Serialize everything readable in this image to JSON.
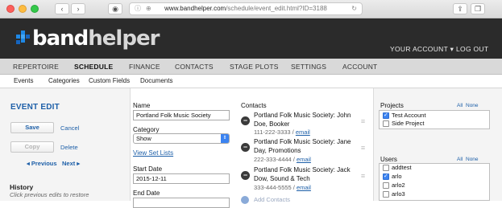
{
  "browser": {
    "url_domain": "www.bandhelper.com",
    "url_path": "/schedule/event_edit.html?ID=3188"
  },
  "header": {
    "logo_band": "band",
    "logo_helper": "helper",
    "your_account": "YOUR ACCOUNT ▾",
    "log_out": "LOG OUT"
  },
  "mainnav": [
    "REPERTOIRE",
    "SCHEDULE",
    "FINANCE",
    "CONTACTS",
    "STAGE PLOTS",
    "SETTINGS",
    "ACCOUNT"
  ],
  "subnav": [
    "Events",
    "Categories",
    "Custom Fields",
    "Documents"
  ],
  "left": {
    "title": "EVENT EDIT",
    "save": "Save",
    "cancel": "Cancel",
    "copy": "Copy",
    "delete": "Delete",
    "previous": "◂ Previous",
    "next": "Next ▸",
    "history": "History",
    "history_hint": "Click previous edits to restore"
  },
  "form": {
    "name_label": "Name",
    "name_value": "Portland Folk Music Society",
    "category_label": "Category",
    "category_value": "Show",
    "view_set_lists": "View Set Lists",
    "start_date_label": "Start Date",
    "start_date_value": "2015-12-11",
    "end_date_label": "End Date"
  },
  "contacts": {
    "label": "Contacts",
    "items": [
      {
        "name": "Portland Folk Music Society: John Doe, Booker",
        "phone": "111-222-3333 / ",
        "email": "email"
      },
      {
        "name": "Portland Folk Music Society: Jane Day, Promotions",
        "phone": "222-333-4444 / ",
        "email": "email"
      },
      {
        "name": "Portland Folk Music Society: Jack Dow, Sound & Tech",
        "phone": "333-444-5555 / ",
        "email": "email"
      }
    ],
    "add_label": "Add Contacts"
  },
  "projects": {
    "label": "Projects",
    "all": "All",
    "none": "None",
    "items": [
      {
        "label": "Test Account",
        "checked": true
      },
      {
        "label": "Side Project",
        "checked": false
      }
    ]
  },
  "users": {
    "label": "Users",
    "all": "All",
    "none": "None",
    "items": [
      {
        "label": "addtest",
        "checked": false
      },
      {
        "label": "arlo",
        "checked": true
      },
      {
        "label": "arlo2",
        "checked": false
      },
      {
        "label": "arlo3",
        "checked": false
      }
    ]
  }
}
